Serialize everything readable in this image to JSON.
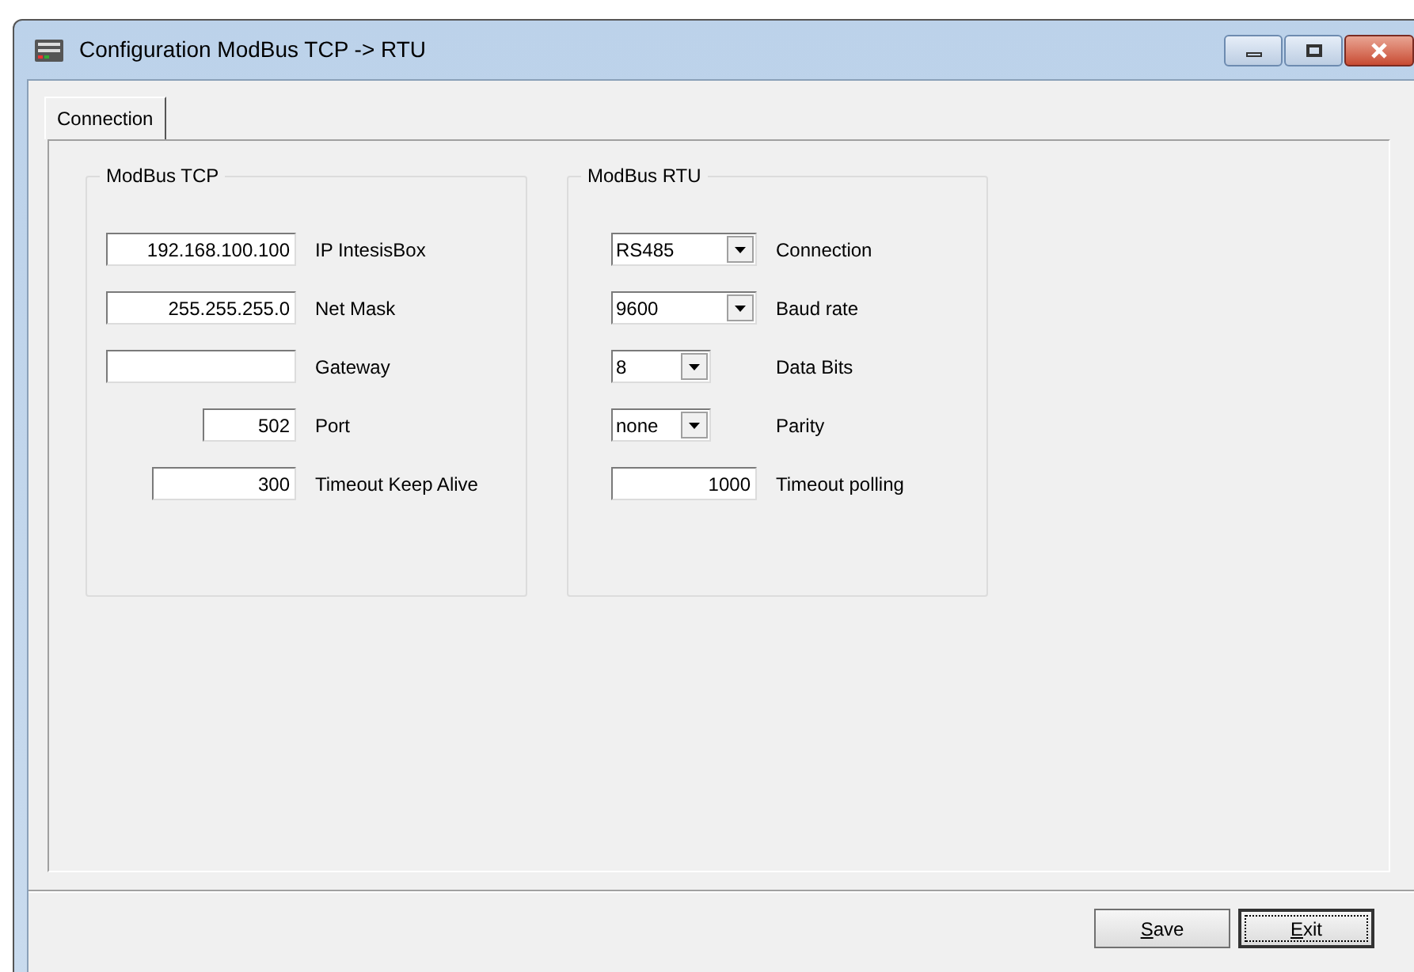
{
  "window": {
    "title": "Configuration ModBus TCP -> RTU"
  },
  "tabs": [
    {
      "label": "Connection",
      "selected": true
    }
  ],
  "groups": [
    {
      "title": "ModBus TCP",
      "fields": [
        {
          "kind": "text",
          "value": "192.168.100.100",
          "label": "IP IntesisBox"
        },
        {
          "kind": "text",
          "value": "255.255.255.0",
          "label": "Net Mask"
        },
        {
          "kind": "text",
          "label": "Gateway"
        },
        {
          "kind": "text",
          "value": "502",
          "label": "Port"
        },
        {
          "kind": "text",
          "value": "300",
          "label": "Timeout Keep Alive"
        }
      ]
    },
    {
      "title": "ModBus RTU",
      "fields": [
        {
          "kind": "combo",
          "value": "RS485",
          "label": "Connection"
        },
        {
          "kind": "combo",
          "value": "9600",
          "label": "Baud rate"
        },
        {
          "kind": "combo",
          "value": "8",
          "label": "Data Bits"
        },
        {
          "kind": "combo",
          "value": "none",
          "label": "Parity"
        },
        {
          "kind": "text",
          "value": "1000",
          "label": "Timeout polling"
        }
      ]
    }
  ],
  "buttons": [
    {
      "label": "Save",
      "focused": false
    },
    {
      "label": "Exit",
      "focused": true
    }
  ]
}
